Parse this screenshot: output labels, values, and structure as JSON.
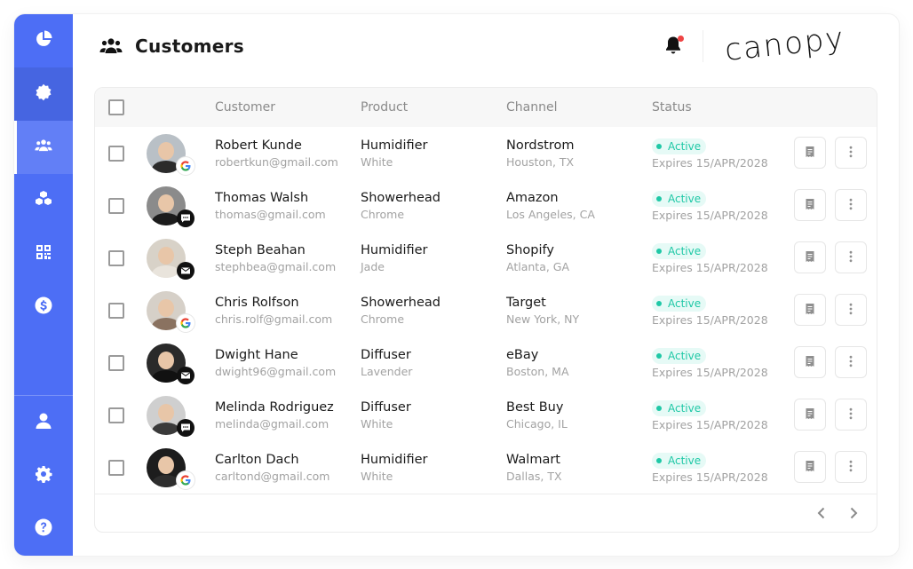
{
  "theme": {
    "accent": "#4d6ef5",
    "status_green": "#1fc8a6"
  },
  "sidebar": {
    "top_items": [
      {
        "icon": "pie-chart-icon"
      },
      {
        "icon": "badge-star-icon"
      },
      {
        "icon": "users-icon",
        "active": true
      },
      {
        "icon": "cubes-icon"
      },
      {
        "icon": "qr-code-icon"
      },
      {
        "icon": "dollar-circle-icon"
      }
    ],
    "bottom_items": [
      {
        "icon": "user-icon"
      },
      {
        "icon": "gear-icon"
      },
      {
        "icon": "help-icon"
      }
    ]
  },
  "header": {
    "title": "Customers",
    "title_icon": "users-icon",
    "notifications_icon": "bell-icon",
    "logo_text": "canopy"
  },
  "table": {
    "columns": [
      "Customer",
      "Product",
      "Channel",
      "Status"
    ],
    "rows": [
      {
        "name": "Robert Kunde",
        "email": "robertkun@gmail.com",
        "product": "Humidifier",
        "variant": "White",
        "channel": "Nordstrom",
        "location": "Houston, TX",
        "status": "Active",
        "expires": "Expires 15/APR/2028",
        "source_icon": "google-icon",
        "avatar_bg": "#b9c0c6",
        "shirt": "#2b2b2b"
      },
      {
        "name": "Thomas Walsh",
        "email": "thomas@gmail.com",
        "product": "Showerhead",
        "variant": "Chrome",
        "channel": "Amazon",
        "location": "Los Angeles, CA",
        "status": "Active",
        "expires": "Expires 15/APR/2028",
        "source_icon": "chat-icon",
        "avatar_bg": "#8b8b8b",
        "shirt": "#1c1c1c"
      },
      {
        "name": "Steph Beahan",
        "email": "stephbea@gmail.com",
        "product": "Humidifier",
        "variant": "Jade",
        "channel": "Shopify",
        "location": "Atlanta, GA",
        "status": "Active",
        "expires": "Expires 15/APR/2028",
        "source_icon": "mail-icon",
        "avatar_bg": "#d8d2c8",
        "shirt": "#e9e4dc"
      },
      {
        "name": "Chris Rolfson",
        "email": "chris.rolf@gmail.com",
        "product": "Showerhead",
        "variant": "Chrome",
        "channel": "Target",
        "location": "New York, NY",
        "status": "Active",
        "expires": "Expires 15/APR/2028",
        "source_icon": "google-icon",
        "avatar_bg": "#d6d0c8",
        "shirt": "#8a7260"
      },
      {
        "name": "Dwight Hane",
        "email": "dwight96@gmail.com",
        "product": "Diffuser",
        "variant": "Lavender",
        "channel": "eBay",
        "location": "Boston, MA",
        "status": "Active",
        "expires": "Expires 15/APR/2028",
        "source_icon": "mail-icon",
        "avatar_bg": "#2a2a2a",
        "shirt": "#111111"
      },
      {
        "name": "Melinda Rodriguez",
        "email": "melinda@gmail.com",
        "product": "Diffuser",
        "variant": "White",
        "channel": "Best Buy",
        "location": "Chicago, IL",
        "status": "Active",
        "expires": "Expires 15/APR/2028",
        "source_icon": "chat-icon",
        "avatar_bg": "#cfcfcf",
        "shirt": "#3a3a3a"
      },
      {
        "name": "Carlton Dach",
        "email": "carltond@gmail.com",
        "product": "Humidifier",
        "variant": "White",
        "channel": "Walmart",
        "location": "Dallas, TX",
        "status": "Active",
        "expires": "Expires 15/APR/2028",
        "source_icon": "google-icon",
        "avatar_bg": "#1d1d1d",
        "shirt": "#2e2e2e"
      }
    ],
    "row_actions": [
      "receipt-icon",
      "more-vertical-icon"
    ],
    "pager": [
      "chevron-left-icon",
      "chevron-right-icon"
    ]
  }
}
